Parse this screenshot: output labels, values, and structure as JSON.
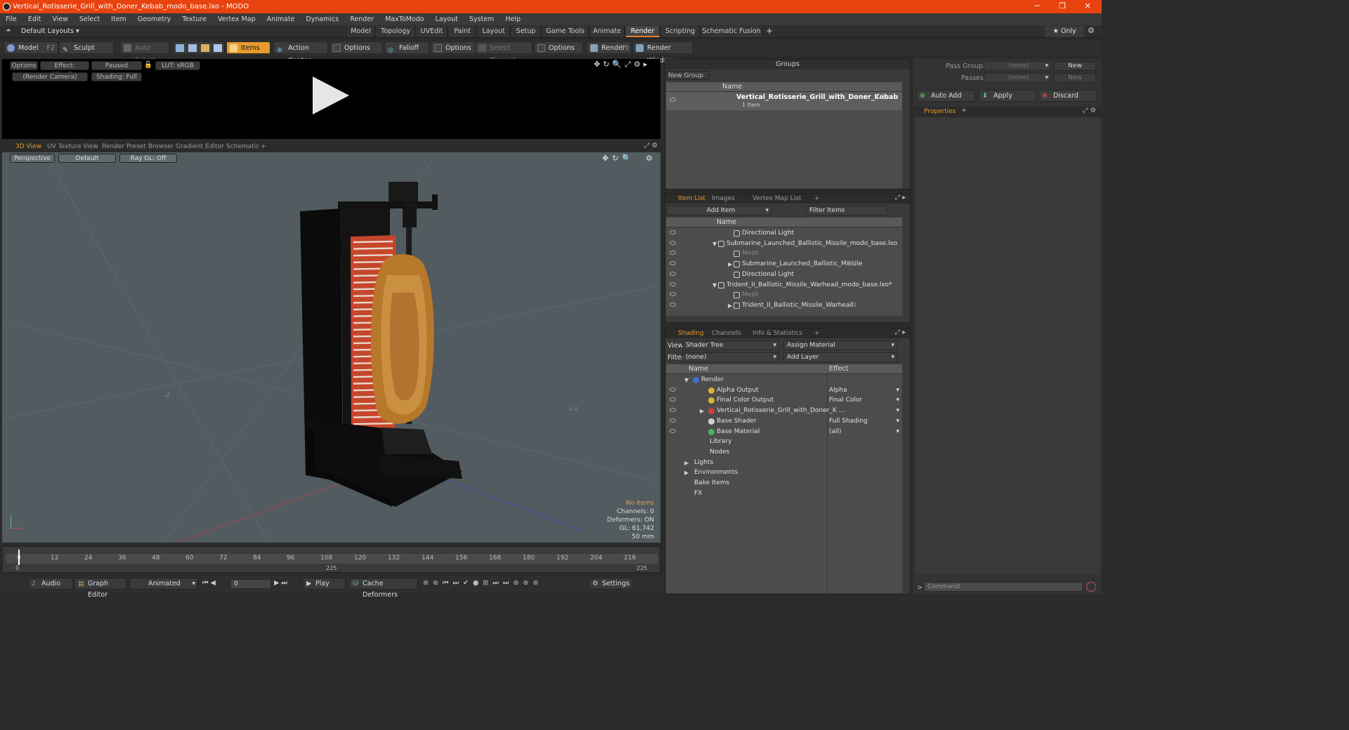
{
  "window": {
    "title": "Vertical_Rotisserie_Grill_with_Doner_Kebab_modo_base.lxo - MODO",
    "controls": [
      "─",
      "❐",
      "✕"
    ]
  },
  "menu": [
    "File",
    "Edit",
    "View",
    "Select",
    "Item",
    "Geometry",
    "Texture",
    "Vertex Map",
    "Animate",
    "Dynamics",
    "Render",
    "MaxToModo",
    "Layout",
    "System",
    "Help"
  ],
  "layouts": {
    "label": "Default Layouts ▾",
    "tabs": [
      "Model",
      "Topology",
      "UVEdit",
      "Paint",
      "Layout",
      "Setup",
      "Game Tools",
      "Animate",
      "Render",
      "Scripting",
      "Schematic Fusion"
    ],
    "active": "Render",
    "plus": "+",
    "only": "★  Only"
  },
  "toolbar": {
    "model": "Model",
    "model_key": "F2",
    "sculpt": "Sculpt",
    "auto_select": "Auto Select",
    "items": "Items",
    "action_center": "Action Center",
    "options1": "Options",
    "falloff": "Falloff",
    "options2": "Options",
    "select_through": "Select Through",
    "options3": "Options",
    "render": "Render",
    "render_key": "F9",
    "render_window": "Render Window"
  },
  "preview": {
    "options": "Options",
    "effect": "Effect: (Shadi...",
    "paused": "Paused",
    "lut": "LUT: sRGB",
    "camera": "(Render Camera)",
    "shading": "Shading: Full"
  },
  "viewtabs": {
    "tabs": [
      "3D View",
      "UV Texture View",
      "Render Preset Browser",
      "Gradient Editor",
      "Schematic"
    ],
    "active": "3D View",
    "plus": "+"
  },
  "viewport": {
    "perspective": "Perspective",
    "default": "Default",
    "raygl": "Ray GL: Off",
    "hud": [
      "No Items",
      "Channels: 0",
      "Deformers: ON",
      "GL: 61,742",
      "50 mm"
    ],
    "axis_z": "-Z",
    "axis_x": "+X"
  },
  "timeline": {
    "ticks": [
      "0",
      "12",
      "24",
      "36",
      "48",
      "60",
      "72",
      "84",
      "96",
      "108",
      "120",
      "132",
      "144",
      "156",
      "168",
      "180",
      "192",
      "204",
      "216"
    ],
    "sub_left": "0",
    "sub_mid": "225",
    "sub_right": "225"
  },
  "bottombar": {
    "audio": "Audio",
    "graph_editor": "Graph Editor",
    "animated": "Animated",
    "frame": "0",
    "play": "Play",
    "cache": "Cache Deformers",
    "settings": "Settings"
  },
  "groups": {
    "title": "Groups",
    "new_group": "New Group",
    "col_name": "Name",
    "item_name": "Vertical_Rotisserie_Grill_with_Doner_Kebab",
    "item_count": "(3)",
    "item_sub": "1 Item"
  },
  "itemlist": {
    "tabs": [
      "Item List",
      "Images",
      "Vertex Map List"
    ],
    "active": "Item List",
    "plus": "+",
    "add_item": "Add Item",
    "filter": "Filter Items",
    "col_name": "Name",
    "rows": [
      {
        "label": "Directional Light",
        "indent": 2,
        "dim": false,
        "arrow": "",
        "count": ""
      },
      {
        "label": "Submarine_Launched_Ballistic_Missile_modo_base.lxo",
        "indent": 1,
        "dim": false,
        "arrow": "▼",
        "count": ""
      },
      {
        "label": "Mesh",
        "indent": 2,
        "dim": true,
        "arrow": "",
        "count": ""
      },
      {
        "label": "Submarine_Launched_Ballistic_Missile",
        "indent": 2,
        "dim": false,
        "arrow": "▶",
        "count": "(2)"
      },
      {
        "label": "Directional Light",
        "indent": 2,
        "dim": false,
        "arrow": "",
        "count": ""
      },
      {
        "label": "Trident_II_Ballistic_Missile_Warhead_modo_base.lxo*",
        "indent": 1,
        "dim": false,
        "arrow": "▼",
        "count": ""
      },
      {
        "label": "Mesh",
        "indent": 2,
        "dim": true,
        "arrow": "",
        "count": ""
      },
      {
        "label": "Trident_II_Ballistic_Missile_Warhead",
        "indent": 2,
        "dim": false,
        "arrow": "▶",
        "count": "(2)"
      }
    ]
  },
  "shading": {
    "tabs": [
      "Shading",
      "Channels",
      "Info & Statistics"
    ],
    "active": "Shading",
    "plus": "+",
    "view_label": "View",
    "view_value": "Shader Tree",
    "assign": "Assign Material",
    "filter_label": "Filter",
    "filter_value": "(none)",
    "add_layer": "Add Layer",
    "col_name": "Name",
    "col_effect": "Effect",
    "rows": [
      {
        "label": "Render",
        "effect": "",
        "indent": 0,
        "arrow": "▼",
        "icon": "#3b6fd6",
        "eye": false
      },
      {
        "label": "Alpha Output",
        "effect": "Alpha",
        "indent": 1,
        "arrow": "",
        "icon": "#d8b43a",
        "eye": true
      },
      {
        "label": "Final Color Output",
        "effect": "Final Color",
        "indent": 1,
        "arrow": "",
        "icon": "#d8b43a",
        "eye": true
      },
      {
        "label": "Vertical_Rotisserie_Grill_with_Doner_K ...",
        "effect": "",
        "indent": 1,
        "arrow": "▶",
        "icon": "#c94040",
        "eye": true
      },
      {
        "label": "Base Shader",
        "effect": "Full Shading",
        "indent": 1,
        "arrow": "",
        "icon": "#cfcfcf",
        "eye": true
      },
      {
        "label": "Base Material",
        "effect": "(all)",
        "indent": 1,
        "arrow": "",
        "icon": "#4fb06a",
        "eye": true
      },
      {
        "label": "Library",
        "effect": "",
        "indent": 1,
        "arrow": "",
        "icon": "",
        "eye": false
      },
      {
        "label": "Nodes",
        "effect": "",
        "indent": 1,
        "arrow": "",
        "icon": "",
        "eye": false
      },
      {
        "label": "Lights",
        "effect": "",
        "indent": 0,
        "arrow": "▶",
        "icon": "",
        "eye": false
      },
      {
        "label": "Environments",
        "effect": "",
        "indent": 0,
        "arrow": "▶",
        "icon": "",
        "eye": false
      },
      {
        "label": "Bake Items",
        "effect": "",
        "indent": 0,
        "arrow": "",
        "icon": "",
        "eye": false
      },
      {
        "label": "FX",
        "effect": "",
        "indent": 0,
        "arrow": "",
        "icon": "",
        "eye": false
      }
    ]
  },
  "passes": {
    "pass_groups": "Pass Groups",
    "passes": "Passes",
    "none": "(none)",
    "new": "New",
    "auto_add": "Auto Add",
    "apply": "Apply",
    "discard": "Discard",
    "properties": "Properties",
    "plus": "+"
  },
  "command": {
    "placeholder": "Command",
    "prompt": ">"
  }
}
